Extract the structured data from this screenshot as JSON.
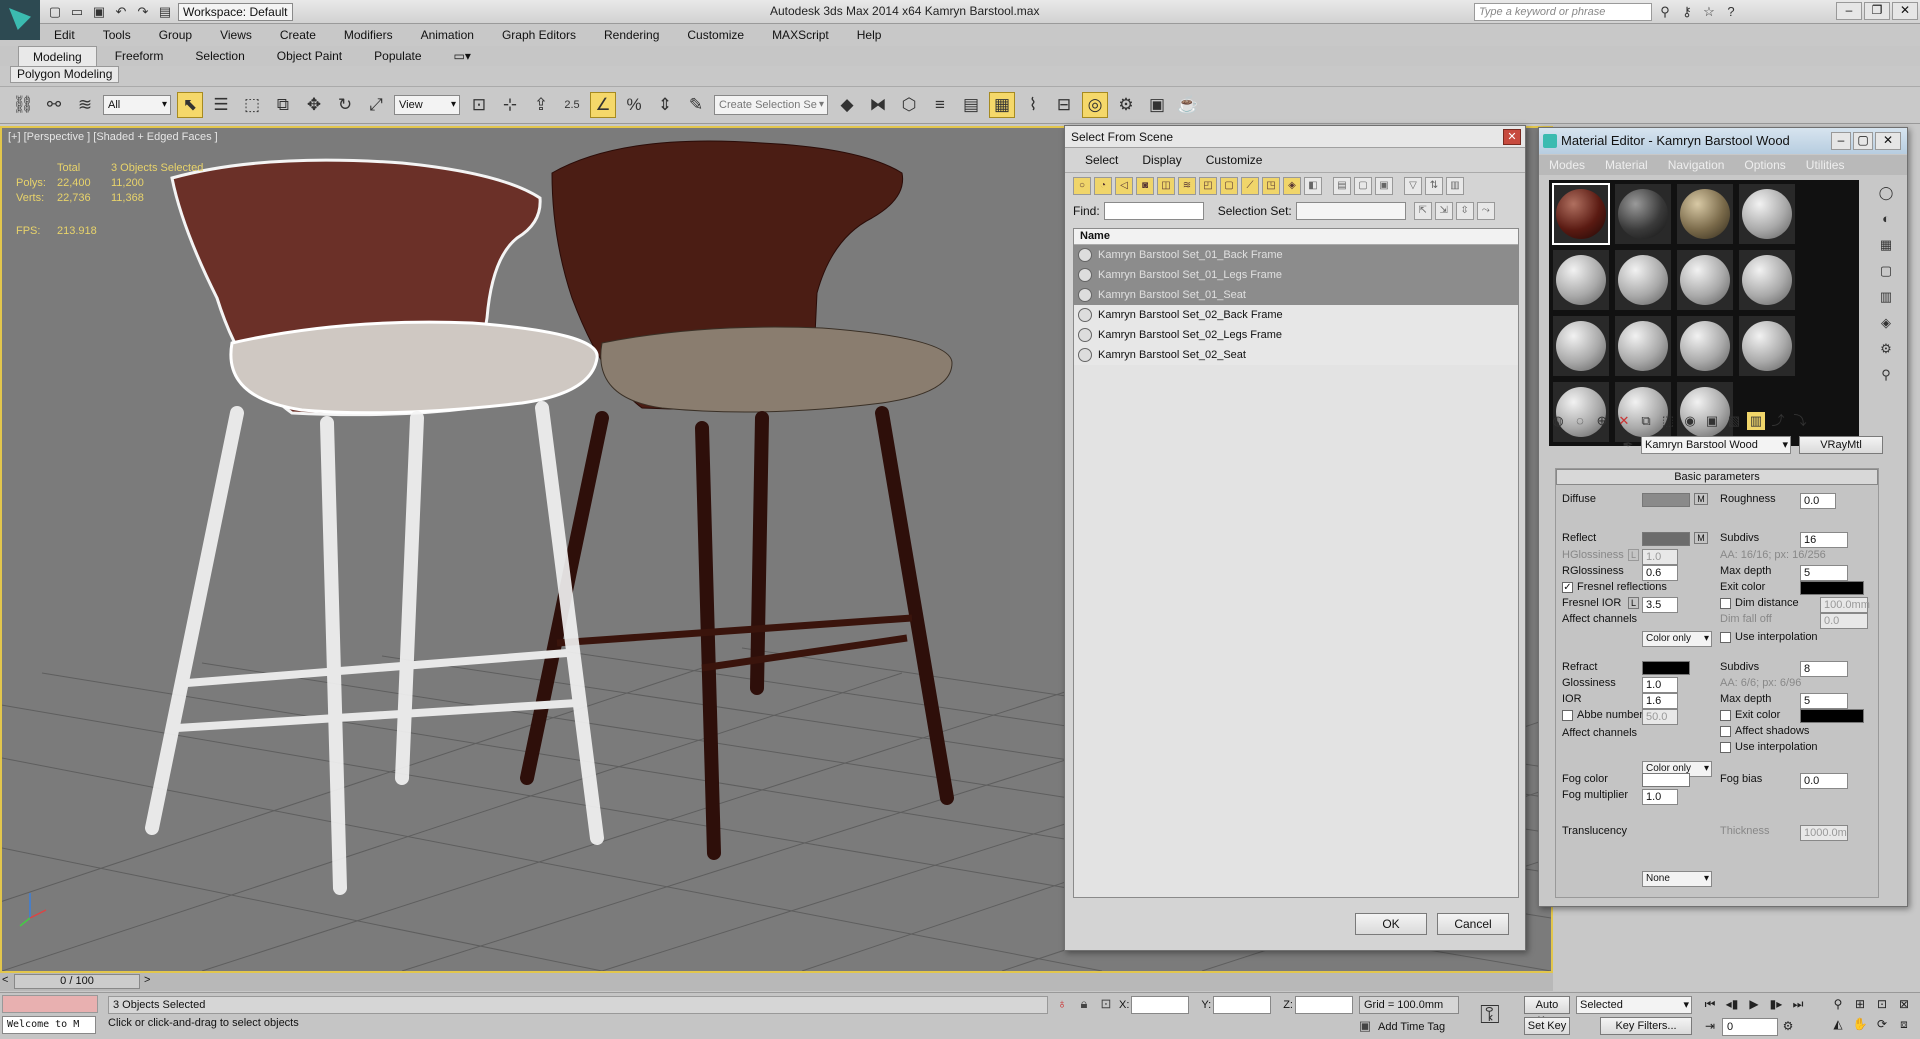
{
  "titlebar": {
    "workspace": "Workspace: Default",
    "app_title": "Autodesk 3ds Max  2014 x64     Kamryn Barstool.max",
    "search_placeholder": "Type a keyword or phrase"
  },
  "menu": [
    "Edit",
    "Tools",
    "Group",
    "Views",
    "Create",
    "Modifiers",
    "Animation",
    "Graph Editors",
    "Rendering",
    "Customize",
    "MAXScript",
    "Help"
  ],
  "ribbon": {
    "tabs": [
      "Modeling",
      "Freeform",
      "Selection",
      "Object Paint",
      "Populate"
    ],
    "active_tab": "Modeling",
    "subpanel": "Polygon Modeling"
  },
  "toolbar": {
    "filter": "All",
    "ref_coord": "View",
    "create_selection_set": "Create Selection Se",
    "snap_angle": "2.5"
  },
  "viewport": {
    "label": "[+] [Perspective ] [Shaded + Edged Faces ]",
    "stats": {
      "total_label": "Total",
      "selected_label": "3 Objects Selected",
      "polys_label": "Polys:",
      "polys_total": "22,400",
      "polys_sel": "11,200",
      "verts_label": "Verts:",
      "verts_total": "22,736",
      "verts_sel": "11,368",
      "fps_label": "FPS:",
      "fps": "213.918"
    }
  },
  "select_from_scene": {
    "title": "Select From Scene",
    "menu": [
      "Select",
      "Display",
      "Customize"
    ],
    "find_label": "Find:",
    "selection_set_label": "Selection Set:",
    "column_name": "Name",
    "rows": [
      {
        "name": "Kamryn Barstool Set_01_Back Frame",
        "selected": true
      },
      {
        "name": "Kamryn Barstool Set_01_Legs Frame",
        "selected": true
      },
      {
        "name": "Kamryn Barstool Set_01_Seat",
        "selected": true
      },
      {
        "name": "Kamryn Barstool Set_02_Back Frame",
        "selected": false
      },
      {
        "name": "Kamryn Barstool Set_02_Legs Frame",
        "selected": false
      },
      {
        "name": "Kamryn Barstool Set_02_Seat",
        "selected": false
      }
    ],
    "ok": "OK",
    "cancel": "Cancel"
  },
  "material_editor": {
    "title": "Material Editor - Kamryn Barstool Wood",
    "menu": [
      "Modes",
      "Material",
      "Navigation",
      "Options",
      "Utilities"
    ],
    "material_name": "Kamryn Barstool Wood",
    "material_type": "VRayMtl",
    "rollout": "Basic parameters",
    "diffuse": {
      "label": "Diffuse",
      "map": "M",
      "roughness_label": "Roughness",
      "roughness": "0.0"
    },
    "reflect": {
      "label": "Reflect",
      "map": "M",
      "subdivs_label": "Subdivs",
      "subdivs": "16",
      "hglossiness_label": "HGlossiness",
      "hglossiness": "1.0",
      "lock": "L",
      "aa": "AA: 16/16; px: 16/256",
      "rglossiness_label": "RGlossiness",
      "rglossiness": "0.6",
      "maxdepth_label": "Max depth",
      "maxdepth": "5",
      "fresnel_label": "Fresnel reflections",
      "exit_color_label": "Exit color",
      "fresnel_ior_label": "Fresnel IOR",
      "fresnel_ior": "3.5",
      "dim_distance_label": "Dim distance",
      "dim_distance": "100.0mm",
      "affect_label": "Affect channels",
      "affect": "Color only",
      "dim_falloff_label": "Dim fall off",
      "dim_falloff": "0.0",
      "use_interp_label": "Use interpolation"
    },
    "refract": {
      "label": "Refract",
      "subdivs_label": "Subdivs",
      "subdivs": "8",
      "glossiness_label": "Glossiness",
      "glossiness": "1.0",
      "aa": "AA: 6/6; px: 6/96",
      "ior_label": "IOR",
      "ior": "1.6",
      "maxdepth_label": "Max depth",
      "maxdepth": "5",
      "abbe_label": "Abbe number",
      "abbe": "50.0",
      "exit_color_label": "Exit color",
      "affect_label": "Affect channels",
      "affect": "Color only",
      "affect_shadows_label": "Affect shadows",
      "use_interp_label": "Use interpolation"
    },
    "fog": {
      "color_label": "Fog color",
      "bias_label": "Fog bias",
      "bias": "0.0",
      "multiplier_label": "Fog multiplier",
      "multiplier": "1.0"
    },
    "translucency": {
      "label": "Translucency",
      "value": "None",
      "thickness_label": "Thickness",
      "thickness": "1000.0m"
    }
  },
  "timeline": {
    "frame": "0 / 100"
  },
  "status": {
    "welcome": "Welcome to M",
    "selected": "3 Objects Selected",
    "prompt": "Click or click-and-drag to select objects",
    "x_label": "X:",
    "y_label": "Y:",
    "z_label": "Z:",
    "grid": "Grid = 100.0mm",
    "add_time_tag": "Add Time Tag",
    "auto_key": "Auto Key",
    "set_key": "Set Key",
    "key_mode": "Selected",
    "key_filters": "Key Filters...",
    "current_frame": "0"
  },
  "colors": {
    "accent": "#f0d56a",
    "viewport_border": "#e2c64c",
    "stats": "#e8d36b",
    "wood": "#5a1a12"
  }
}
